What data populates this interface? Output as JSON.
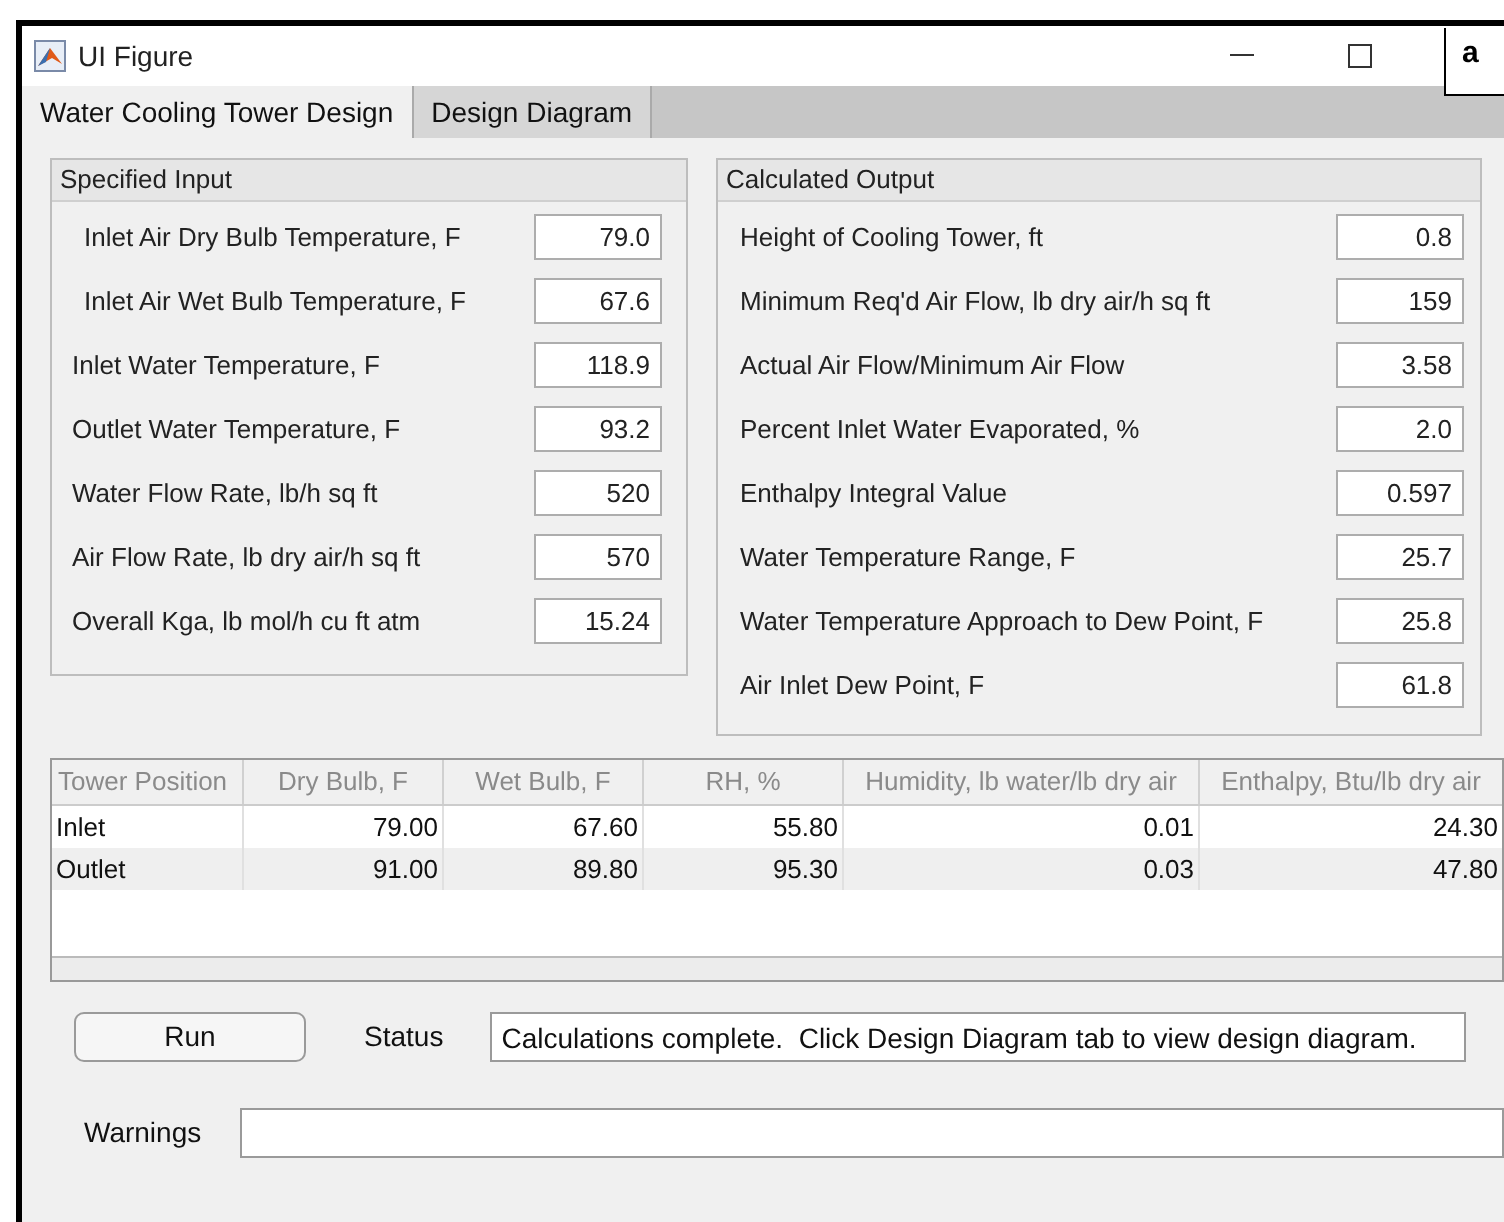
{
  "window": {
    "title": "UI Figure"
  },
  "panel_label": "a",
  "tabs": [
    {
      "label": "Water Cooling Tower Design",
      "selected": true
    },
    {
      "label": "Design Diagram",
      "selected": false
    }
  ],
  "specified_input": {
    "title": "Specified Input",
    "fields": [
      {
        "label": "Inlet Air Dry Bulb Temperature, F",
        "value": "79.0"
      },
      {
        "label": "Inlet Air Wet Bulb Temperature, F",
        "value": "67.6"
      },
      {
        "label": "Inlet Water Temperature, F",
        "value": "118.9"
      },
      {
        "label": "Outlet Water Temperature, F",
        "value": "93.2"
      },
      {
        "label": "Water Flow Rate, lb/h sq ft",
        "value": "520"
      },
      {
        "label": "Air Flow Rate, lb dry air/h sq ft",
        "value": "570"
      },
      {
        "label": "Overall Kga, lb mol/h cu ft atm",
        "value": "15.24"
      }
    ]
  },
  "calculated_output": {
    "title": "Calculated Output",
    "fields": [
      {
        "label": "Height of Cooling Tower, ft",
        "value": "0.8"
      },
      {
        "label": "Minimum Req'd Air Flow, lb dry air/h sq ft",
        "value": "159"
      },
      {
        "label": "Actual Air Flow/Minimum Air Flow",
        "value": "3.58"
      },
      {
        "label": "Percent Inlet Water Evaporated, %",
        "value": "2.0"
      },
      {
        "label": "Enthalpy Integral Value",
        "value": "0.597"
      },
      {
        "label": "Water Temperature Range, F",
        "value": "25.7"
      },
      {
        "label": "Water Temperature Approach to Dew Point, F",
        "value": "25.8"
      },
      {
        "label": "Air Inlet Dew Point, F",
        "value": "61.8"
      }
    ]
  },
  "table": {
    "columns": [
      "Tower Position",
      "Dry Bulb, F",
      "Wet Bulb, F",
      "RH, %",
      "Humidity, lb water/lb dry air",
      "Enthalpy, Btu/lb dry air"
    ],
    "rows": [
      [
        "Inlet",
        "79.00",
        "67.60",
        "55.80",
        "0.01",
        "24.30"
      ],
      [
        "Outlet",
        "91.00",
        "89.80",
        "95.30",
        "0.03",
        "47.80"
      ]
    ]
  },
  "run_button": "Run",
  "status": {
    "label": "Status",
    "value": "Calculations complete.  Click Design Diagram tab to view design diagram."
  },
  "warnings": {
    "label": "Warnings"
  }
}
